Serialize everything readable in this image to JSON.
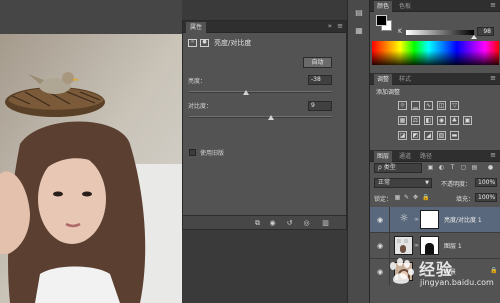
{
  "properties_panel": {
    "tab_label": "属性",
    "collapse_icon": "double-chevron-right",
    "menu_icon": "panel-menu",
    "title": "亮度/对比度",
    "auto_button": "自动",
    "brightness_label": "亮度：",
    "brightness_value": "-38",
    "contrast_label": "对比度：",
    "contrast_value": "9",
    "legacy_label": "使用旧版",
    "legacy_checked": false
  },
  "color_panel": {
    "tabs": [
      "颜色",
      "色板"
    ],
    "k_label": "K",
    "k_value": "98",
    "foreground": "#000000",
    "background": "#ffffff"
  },
  "adjustments_panel": {
    "tabs": [
      "调整",
      "样式"
    ],
    "title": "添加调整"
  },
  "layers_panel": {
    "tabs": [
      "图层",
      "通道",
      "路径"
    ],
    "filter_label": "ρ 类型",
    "blend_mode": "正常",
    "opacity_label": "不透明度：",
    "opacity_value": "100%",
    "lock_label": "锁定：",
    "fill_label": "填充：",
    "fill_value": "100%",
    "layers": [
      {
        "name": "亮度/对比度 1",
        "selected": true
      },
      {
        "name": "图层 1",
        "selected": false
      },
      {
        "name": "背景",
        "selected": false
      }
    ]
  },
  "watermark": {
    "text": "经验",
    "url": "jingyan.baidu.com"
  },
  "accent_colors": {
    "selected_layer": "#59687c",
    "panel_bg": "#535353"
  }
}
